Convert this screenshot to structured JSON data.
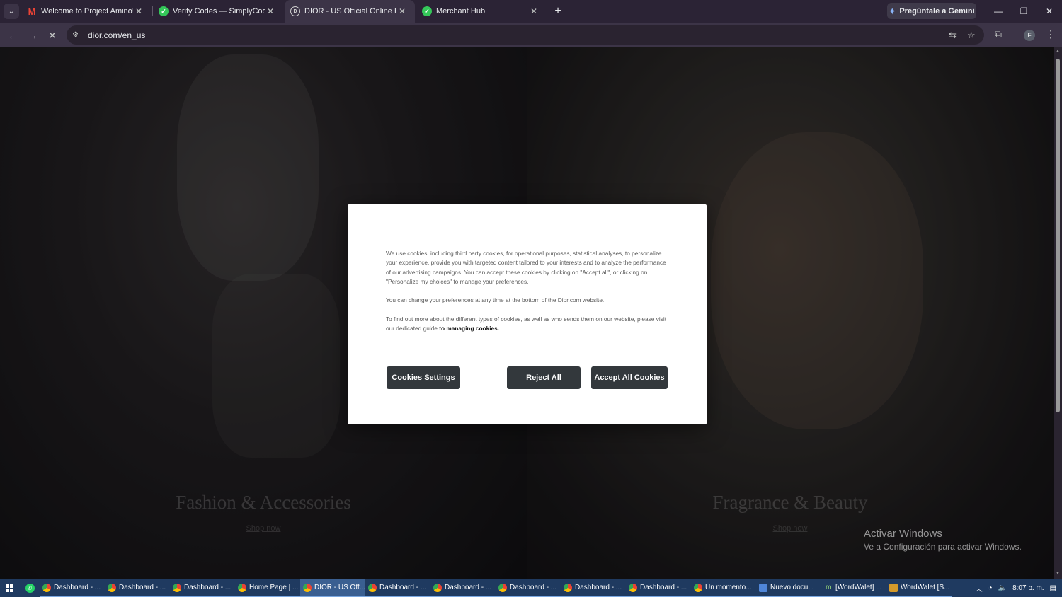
{
  "browser": {
    "tabs": [
      {
        "title": "Welcome to Project Amino! - fr",
        "icon": "gmail-icon"
      },
      {
        "title": "Verify Codes — SimplyCodes",
        "icon": "simplycodes-icon"
      },
      {
        "title": "DIOR - US Official Online Bouti",
        "icon": "dior-icon",
        "active": true
      },
      {
        "title": "Merchant Hub",
        "icon": "simplycodes-icon"
      }
    ],
    "new_tab": "+",
    "gemini_label": "Pregúntale a Gemini",
    "profile_initial": "F",
    "url": "dior.com/en_us"
  },
  "page": {
    "left_category": "Fashion & Accessories",
    "left_cta": "Shop now",
    "right_category": "Fragrance & Beauty",
    "right_cta": "Shop now"
  },
  "cookie_modal": {
    "paragraph1": "We use cookies, including third party cookies, for operational purposes, statistical analyses, to personalize your experience, provide you with targeted content tailored to your interests and to analyze the performance of our advertising campaigns. You can accept these cookies by clicking on \"Accept all\", or clicking on \"Personalize my choices\" to manage your preferences.",
    "paragraph2": "You can change your preferences at any time at the bottom of the Dior.com website.",
    "paragraph3_prefix": "To find out more about the different types of cookies, as well as who sends them on our website, please visit our dedicated guide ",
    "paragraph3_link": "to managing cookies.",
    "settings_button": "Cookies Settings",
    "reject_button": "Reject All",
    "accept_button": "Accept All Cookies"
  },
  "watermark": {
    "title": "Activar Windows",
    "subtitle": "Ve a Configuración para activar Windows."
  },
  "taskbar": {
    "items": [
      {
        "label": "Dashboard - ...",
        "icon": "chrome"
      },
      {
        "label": "Dashboard - ...",
        "icon": "chrome"
      },
      {
        "label": "Dashboard - ...",
        "icon": "chrome"
      },
      {
        "label": "Home Page | ...",
        "icon": "chrome"
      },
      {
        "label": "DIOR - US Off...",
        "icon": "chrome"
      },
      {
        "label": "Dashboard - ...",
        "icon": "chrome"
      },
      {
        "label": "Dashboard - ...",
        "icon": "chrome"
      },
      {
        "label": "Dashboard - ...",
        "icon": "chrome"
      },
      {
        "label": "Dashboard - ...",
        "icon": "chrome"
      },
      {
        "label": "Dashboard - ...",
        "icon": "chrome"
      },
      {
        "label": "Un momento...",
        "icon": "chrome"
      },
      {
        "label": "Nuevo docu...",
        "icon": "doc"
      },
      {
        "label": "[WordWalet] ...",
        "icon": "m"
      },
      {
        "label": "WordWalet [S...",
        "icon": "wordwalet"
      }
    ],
    "clock": "8:07 p. m."
  }
}
